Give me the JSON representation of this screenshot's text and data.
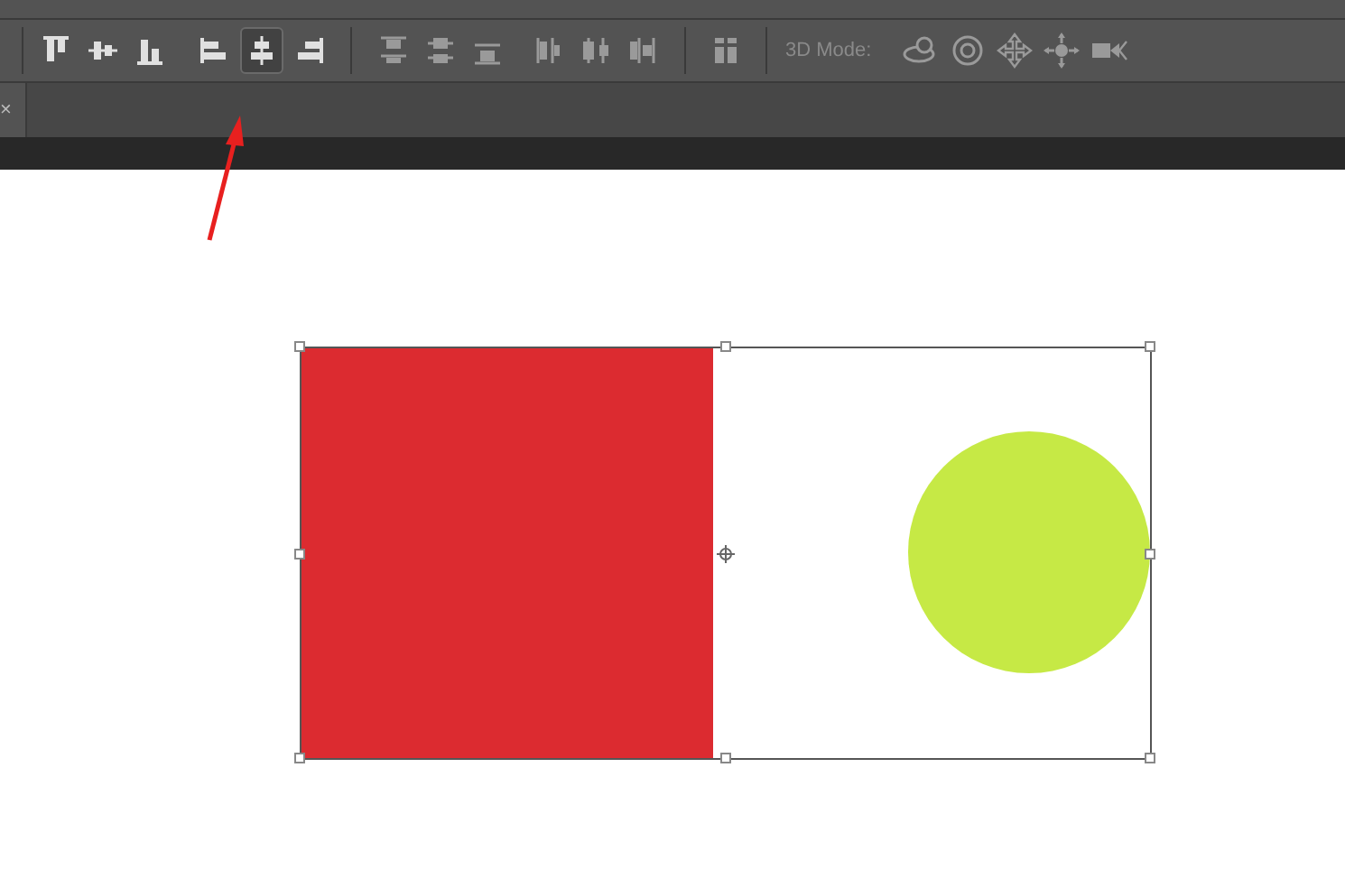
{
  "toolbar": {
    "align_buttons": [
      {
        "kind": "align-top",
        "selected": false
      },
      {
        "kind": "align-vcenter",
        "selected": false
      },
      {
        "kind": "align-bottom",
        "selected": false
      },
      {
        "kind": "align-left",
        "selected": false
      },
      {
        "kind": "align-hcenter",
        "selected": true
      },
      {
        "kind": "align-right",
        "selected": false
      }
    ],
    "mode_label": "3D Mode:"
  },
  "document_tab": {
    "close": "×"
  }
}
